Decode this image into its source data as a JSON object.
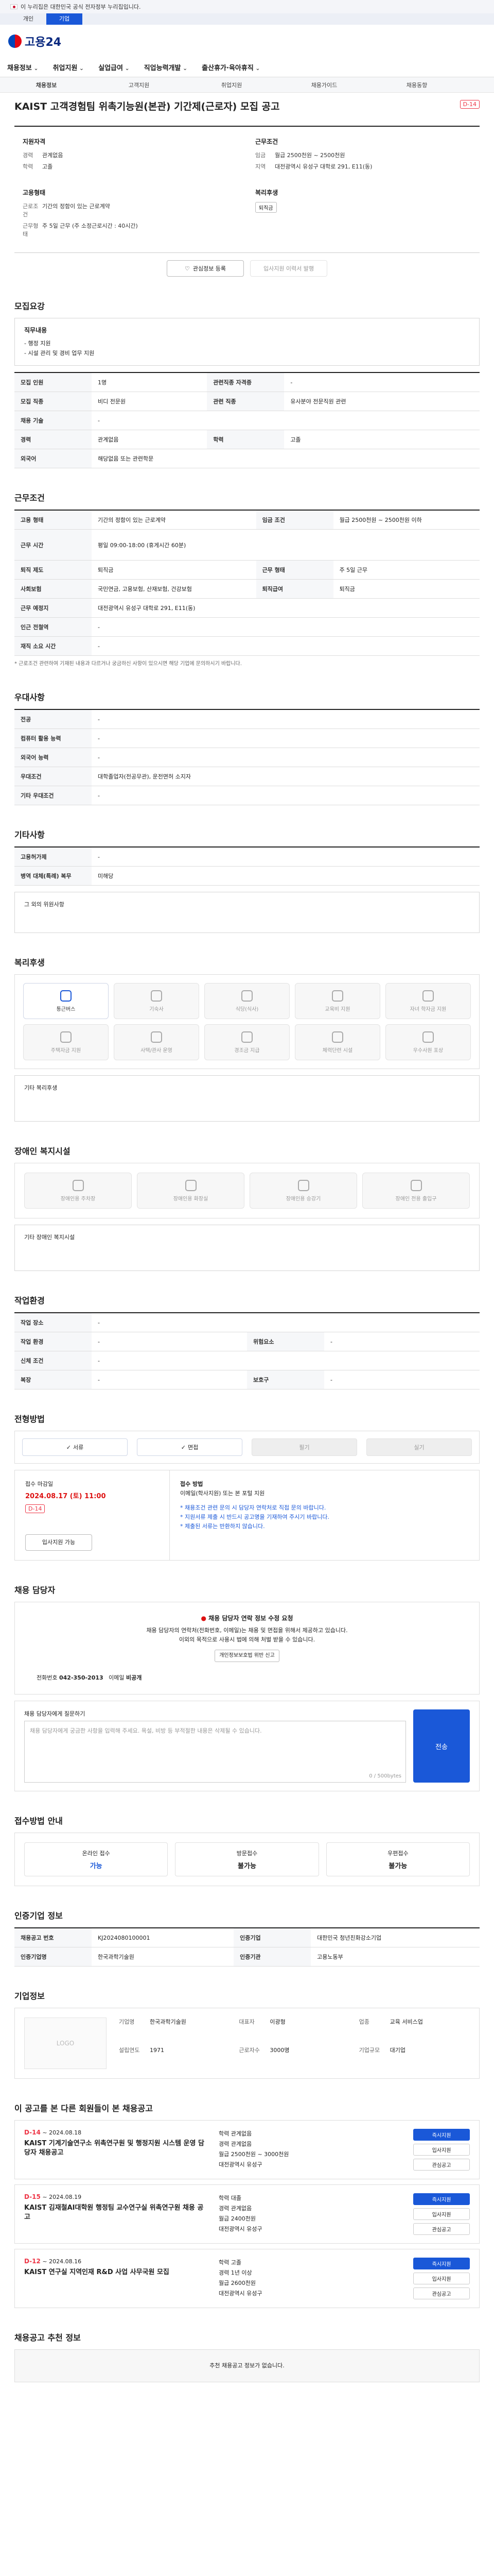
{
  "gov_banner": "이 누리집은 대한민국 공식 전자정부 누리집입니다.",
  "top_tabs": [
    "개인",
    "기업"
  ],
  "brand": {
    "name": "고용24",
    "accent": "#1a58d8"
  },
  "gnb": [
    "채용정보",
    "취업지원",
    "실업급여",
    "직업능력개발",
    "출산휴가·육아휴직"
  ],
  "subnav": [
    "채용정보",
    "고객지원",
    "취업지원",
    "채용가이드",
    "채용동향",
    "전체메뉴"
  ],
  "title": "KAIST 고객경험팀 위촉기능원(본관) 기간제(근로자) 모집 공고",
  "dday": "D-14",
  "summary": {
    "company_h": "지원자격",
    "company": [
      [
        "경력",
        "관계없음"
      ],
      [
        "학력",
        "고졸"
      ]
    ],
    "cond_h": "근무조건",
    "cond": [
      [
        "임금",
        "월급 2500천원 ~ 2500천원"
      ],
      [
        "지역",
        "대전광역시 유성구 대학로 291, E11(동)"
      ]
    ],
    "type_h": "고용형태",
    "type": [
      [
        "근로조건",
        "기간의 정함이 있는 근로계약"
      ],
      [
        "근무형태",
        "주 5일 근무 (주 소정근로시간 : 40시간)"
      ]
    ],
    "benefit_h": "복리후생",
    "benefit_pill": "퇴직금"
  },
  "actions": {
    "scrap": "관심정보 등록",
    "share": "입사지원 이력서 발행"
  },
  "sec_intake": "모집요강",
  "intake_box": {
    "h": "직무내용",
    "lines": [
      "- 행정 지원",
      "- 시설 관리 및 경비 업무 지원"
    ]
  },
  "intake_table": [
    [
      "모집 인원",
      "1명",
      "관련직종 자격증",
      "-"
    ],
    [
      "모집 직종",
      "비디 전문원",
      "관련 직종",
      "유사분야 전문직원 관련"
    ],
    [
      "채용 기술",
      "-",
      "",
      ""
    ],
    [
      "경력",
      "관계없음",
      "학력",
      "고졸"
    ],
    [
      "외국어",
      "해당없음 또는 관련학문",
      "",
      ""
    ]
  ],
  "sec_work": "근무조건",
  "work_table": [
    [
      "고용 형태",
      "기간의 정함이 있는 근로계약",
      "임금 조건",
      "월급 2500천원 ~ 2500천원 이하"
    ],
    [
      "근무 시간",
      "평일 09:00-18:00 (휴게시간 60분)",
      "",
      ""
    ],
    [
      "퇴직 제도",
      "퇴직금",
      "근무 형태",
      "주 5일 근무"
    ],
    [
      "사회보험",
      "국민연금, 고용보험, 산재보험, 건강보험",
      "퇴직급여",
      "퇴직금"
    ],
    [
      "근무 예정지",
      "대전광역시 유성구 대학로 291, E11(동)",
      "",
      ""
    ],
    [
      "인근 전철역",
      "-",
      "",
      ""
    ],
    [
      "재직 소요 시간",
      "-",
      "",
      ""
    ]
  ],
  "work_note": "* 근로조건 관련하여 기재된 내용과 다르거나 궁금하신 사항이 있으시면 해당 기업에 문의하시기 바랍니다.",
  "sec_pref": "우대사항",
  "pref_table": [
    [
      "전공",
      "-"
    ],
    [
      "컴퓨터 활용 능력",
      "-"
    ],
    [
      "외국어 능력",
      "-"
    ],
    [
      "우대조건",
      "대학졸업자(전공무관), 운전면허 소지자"
    ],
    [
      "기타 우대조건",
      "-"
    ]
  ],
  "sec_etc": "기타사항",
  "etc_table": [
    [
      "고용허가제",
      "-"
    ],
    [
      "병역 대체(특례) 복무",
      "미해당"
    ]
  ],
  "etc_box": "그 외의 위원사항",
  "sec_welfare": "복리후생",
  "welfare_items": [
    "통근버스",
    "기숙사",
    "식당(식사)",
    "교육비 지원",
    "자녀 학자금 지원",
    "주택자금 지원",
    "사택/관사 운영",
    "경조금 지급",
    "체력단련 시설",
    "우수사원 포상"
  ],
  "welfare_note": "기타 복리후생",
  "sec_disabled": "장애인 복지시설",
  "disabled_items": [
    "장애인용 주차장",
    "장애인용 화장실",
    "장애인용 승강기",
    "장애인 전용 출입구"
  ],
  "disabled_note": "기타 장애인 복지시설",
  "sec_company_h": "작업환경",
  "env_table": [
    [
      "작업 장소",
      "-",
      "",
      ""
    ],
    [
      "작업 환경",
      "-",
      "위험요소",
      "-"
    ],
    [
      "신체 조건",
      "-",
      "",
      ""
    ],
    [
      "복장",
      "-",
      "보호구",
      "-"
    ]
  ],
  "sec_process": "전형방법",
  "process": [
    "서류",
    "면접",
    "필기",
    "실기"
  ],
  "deadline": {
    "label": "접수 마감일",
    "date": "2024.08.17 (토) 11:00",
    "dday": "D-14",
    "apply_btn": "입사지원 가능",
    "method_h": "접수 방법",
    "method": "이메일(학사지원) 또는 본 포털 지원"
  },
  "apply_notes": [
    "* 채용조건 관련 문의 시 담당자 연락처로 직접 문의 바랍니다.",
    "* 지원서류 제출 시 반드시 공고명을 기재하여 주시기 바랍니다.",
    "* 제출된 서류는 반환하지 않습니다."
  ],
  "sec_contact": "채용 담당자",
  "contact_box": {
    "title": "채용 담당자 연락 정보 수정 요청",
    "line1": "채용 담당자의 연락처(전화번호, 이메일)는 채용 및 면접을 위해서 제공하고 있습니다.",
    "line2": "이외의 목적으로 사용시 법에 의해 처벌 받을 수 있습니다.",
    "btn": "개인정보보호법 위반 신고"
  },
  "contact_tel": {
    "k": "전화번호",
    "v": "042-350-2013",
    "k2": "이메일",
    "v2": "비공개"
  },
  "question": {
    "label": "채용 담당자에게 질문하기",
    "placeholder": "채용 담당자에게 궁금한 사항을 입력해 주세요. 욕설, 비방 등 부적절한 내용은 삭제될 수 있습니다.",
    "count": "0 / 500bytes",
    "send": "전송"
  },
  "sec_method": "접수방법 안내",
  "methods": [
    [
      "온라인 접수",
      "가능"
    ],
    [
      "방문접수",
      "불가능"
    ],
    [
      "우편접수",
      "불가능"
    ]
  ],
  "sec_info": "인증기업 정보",
  "info_table": [
    [
      "채용공고 번호",
      "KJ2024080100001",
      "인증기업",
      "대한민국 청년친화강소기업"
    ],
    [
      "인증기업명",
      "한국과학기술원",
      "인증기관",
      "고용노동부"
    ]
  ],
  "sec_corp": "기업정보",
  "corp": {
    "logo": "LOGO",
    "k": [
      "기업명",
      "대표자",
      "업종",
      "설립연도",
      "근로자수",
      "기업규모"
    ],
    "v": [
      "한국과학기술원",
      "이광형",
      "교육 서비스업",
      "1971",
      "3000명",
      "대기업"
    ]
  },
  "sec_similar": "이 공고를 본 다른 회원들이 본 채용공고",
  "cards": [
    {
      "dday": "D-14",
      "date": "~ 2024.08.18",
      "title": "KAIST 기계기술연구소 위촉연구원 및 행정지원 시스템 운영 담당자 채용공고",
      "m": [
        "학력 관계없음",
        "경력 관계없음",
        "월급 2500천원 ~ 3000천원",
        "대전광역시 유성구"
      ]
    },
    {
      "dday": "D-15",
      "date": "~ 2024.08.19",
      "title": "KAIST 김재철AI대학원 행정팀 교수연구실 위촉연구원 채용 공고",
      "m": [
        "학력 대졸",
        "경력 관계없음",
        "월급 2400천원",
        "대전광역시 유성구"
      ]
    },
    {
      "dday": "D-12",
      "date": "~ 2024.08.16",
      "title": "KAIST 연구실 지역인재 R&D 사업 사무국원 모집",
      "m": [
        "학력 고졸",
        "경력 1년 이상",
        "월급 2600천원",
        "대전광역시 유성구"
      ]
    }
  ],
  "card_btns": [
    "즉시지원",
    "입사지원",
    "관심공고"
  ],
  "sec_recommend": "채용공고 추천 정보",
  "recommend": "추천 채용공고 정보가 없습니다."
}
